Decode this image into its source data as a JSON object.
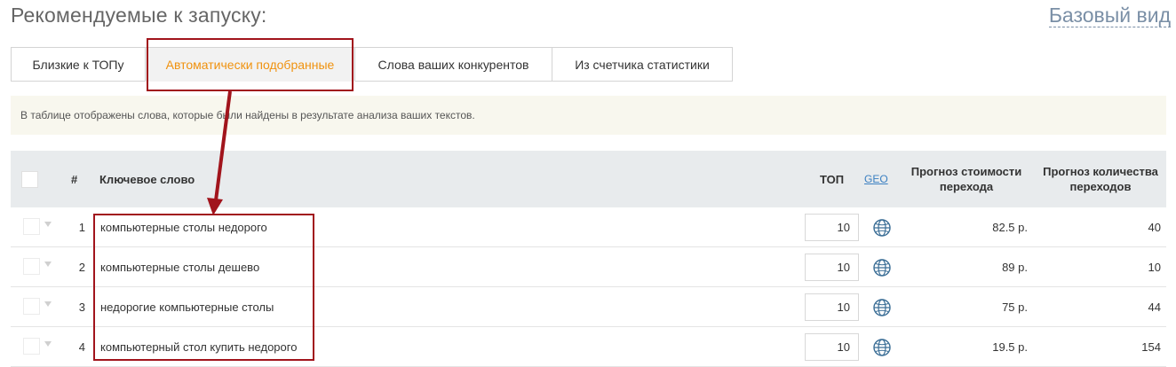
{
  "header": {
    "title": "Рекомендуемые к запуску:",
    "base_view": "Базовый вид"
  },
  "tabs": [
    {
      "label": "Близкие к ТОПу",
      "active": false
    },
    {
      "label": "Автоматически подобранные",
      "active": true
    },
    {
      "label": "Слова ваших конкурентов",
      "active": false
    },
    {
      "label": "Из счетчика статистики",
      "active": false
    }
  ],
  "info": {
    "text": "В таблице отображены слова, которые были найдены в результате анализа ваших текстов."
  },
  "table": {
    "columns": {
      "num": "#",
      "keyword": "Ключевое слово",
      "top": "ТОП",
      "geo": "GEO",
      "cost_line1": "Прогноз стоимости",
      "cost_line2": "перехода",
      "count_line1": "Прогноз количества",
      "count_line2": "переходов"
    },
    "rows": [
      {
        "num": "1",
        "keyword": "компьютерные столы недорого",
        "top": "10",
        "cost": "82.5 р.",
        "count": "40"
      },
      {
        "num": "2",
        "keyword": "компьютерные столы дешево",
        "top": "10",
        "cost": "89 р.",
        "count": "10"
      },
      {
        "num": "3",
        "keyword": "недорогие компьютерные столы",
        "top": "10",
        "cost": "75 р.",
        "count": "44"
      },
      {
        "num": "4",
        "keyword": "компьютерный стол купить недорого",
        "top": "10",
        "cost": "19.5 р.",
        "count": "154"
      }
    ]
  },
  "colors": {
    "active_tab_text": "#f0920f",
    "annotation_red": "#a1141c",
    "info_bg": "#f8f7ee",
    "header_bg": "#e8ebed",
    "link_blue": "#3a7fc1"
  },
  "icons": {
    "geo": "globe-icon",
    "row_menu": "caret-down-icon"
  }
}
